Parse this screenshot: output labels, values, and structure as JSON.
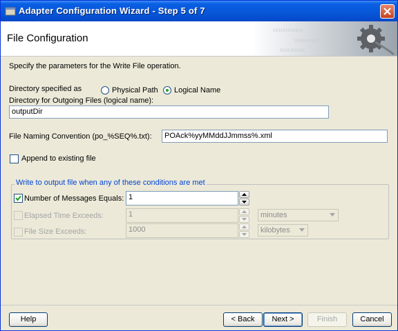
{
  "window": {
    "title": "Adapter Configuration Wizard - Step 5 of 7"
  },
  "header": {
    "title": "File Configuration"
  },
  "intro": "Specify the parameters for the Write File operation.",
  "directory": {
    "label": "Directory specified as",
    "options": [
      {
        "label": "Physical Path",
        "checked": false
      },
      {
        "label": "Logical Name",
        "checked": true
      }
    ],
    "outgoing_label": "Directory for Outgoing Files (logical name):",
    "outgoing_value": "outputDir"
  },
  "file_naming": {
    "label": "File Naming Convention (po_%SEQ%.txt):",
    "value": "POAck%yyMMddJJmmss%.xml"
  },
  "append": {
    "label": "Append to existing file",
    "checked": false
  },
  "conditions": {
    "group_title": "Write to output file when any of these conditions are met",
    "rows": [
      {
        "label": "Number of Messages Equals:",
        "checked": true,
        "enabled": true,
        "value": "1",
        "unit": ""
      },
      {
        "label": "Elapsed Time Exceeds:",
        "checked": false,
        "enabled": false,
        "value": "1",
        "unit": "minutes"
      },
      {
        "label": "File Size Exceeds:",
        "checked": false,
        "enabled": false,
        "value": "1000",
        "unit": "kilobytes"
      }
    ]
  },
  "buttons": {
    "help": "Help",
    "back": "< Back",
    "next": "Next >",
    "finish": "Finish",
    "cancel": "Cancel"
  },
  "colors": {
    "title_bar": "#0756d8",
    "group_title": "#0046d5",
    "dialog_bg": "#ece9d8"
  }
}
